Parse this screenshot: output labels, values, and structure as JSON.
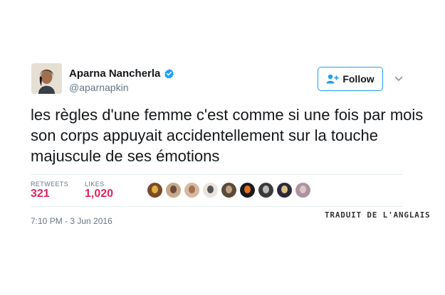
{
  "author": {
    "name": "Aparna Nancherla",
    "handle": "@aparnapkin",
    "verified_icon": "verified-badge-icon"
  },
  "follow_button": {
    "label": "Follow",
    "icon": "follow-user-plus-icon"
  },
  "menu_caret_icon": "chevron-down-icon",
  "tweet": {
    "text": "les règles d'une femme c'est comme si une fois par mois son corps appuyait accidentellement sur la touche majuscule de ses émotions"
  },
  "stats": {
    "retweets_label": "RETWEETS",
    "retweets_value": "321",
    "likes_label": "LIKES",
    "likes_value": "1,020"
  },
  "likers": [
    {
      "color": "#7a4a2a",
      "accent": "#e0b040"
    },
    {
      "color": "#c8a888",
      "accent": "#6a4a3a"
    },
    {
      "color": "#d8b8a0",
      "accent": "#a07050"
    },
    {
      "color": "#ece4dc",
      "accent": "#555555"
    },
    {
      "color": "#5a4a3a",
      "accent": "#c0a080"
    },
    {
      "color": "#1a1a1a",
      "accent": "#e07020"
    },
    {
      "color": "#3a3a3a",
      "accent": "#bbbbbb"
    },
    {
      "color": "#2a2a3a",
      "accent": "#e0c080"
    },
    {
      "color": "#b090a0",
      "accent": "#d8c8c8"
    }
  ],
  "timestamp": "7:10 PM - 3 Jun 2016",
  "translation_note": "TRADUIT DE L'ANGLAIS",
  "colors": {
    "accent_blue": "#1da1f2",
    "like_red": "#e0245e",
    "muted_gray": "#657786"
  }
}
